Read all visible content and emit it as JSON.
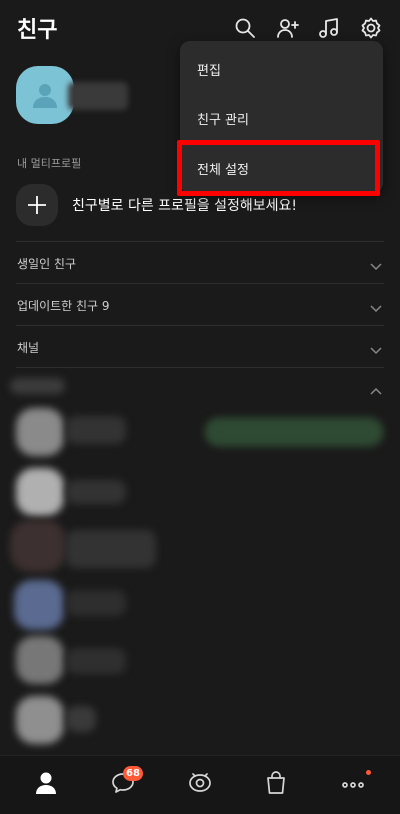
{
  "header": {
    "title": "친구"
  },
  "profile": {
    "name": ""
  },
  "multi_profile": {
    "section_label": "내 멀티프로필",
    "prompt": "친구별로 다른 프로필을 설정해보세요!"
  },
  "rows": [
    {
      "label": "생일인 친구"
    },
    {
      "label": "업데이트한 친구 9"
    },
    {
      "label": "채널"
    }
  ],
  "dropdown": {
    "items": [
      "편집",
      "친구 관리",
      "전체 설정"
    ],
    "highlighted": "전체 설정",
    "highlight_color": "#ff0000"
  },
  "tabbar": {
    "tabs": [
      "friends",
      "chats",
      "view",
      "shopping",
      "more"
    ],
    "chat_badge": "68"
  },
  "colors": {
    "background": "#1a1a1a",
    "avatar": "#7dc3d6",
    "badge": "#ff5a37"
  }
}
